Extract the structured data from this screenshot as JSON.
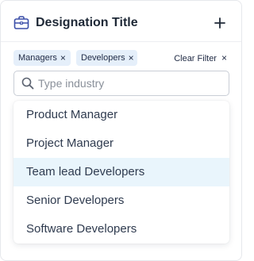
{
  "header": {
    "title": "Designation Title",
    "icon": "briefcase-icon",
    "add_icon": "plus-icon"
  },
  "filters": {
    "chips": [
      {
        "label": "Managers"
      },
      {
        "label": "Developers"
      }
    ],
    "chip_remove_glyph": "×",
    "clear_label": "Clear Filter",
    "clear_glyph": "×"
  },
  "search": {
    "placeholder": "Type industry",
    "value": ""
  },
  "dropdown": {
    "options": [
      {
        "label": "Product Manager"
      },
      {
        "label": "Project Manager"
      },
      {
        "label": "Team lead Developers"
      },
      {
        "label": "Senior Developers"
      },
      {
        "label": "Software Developers"
      }
    ],
    "highlighted_index": 2
  },
  "colors": {
    "accent": "#3b4fa8",
    "chip_bg": "#e5effa",
    "highlight_bg": "#e9f5fc",
    "text": "#2f3b4f"
  }
}
